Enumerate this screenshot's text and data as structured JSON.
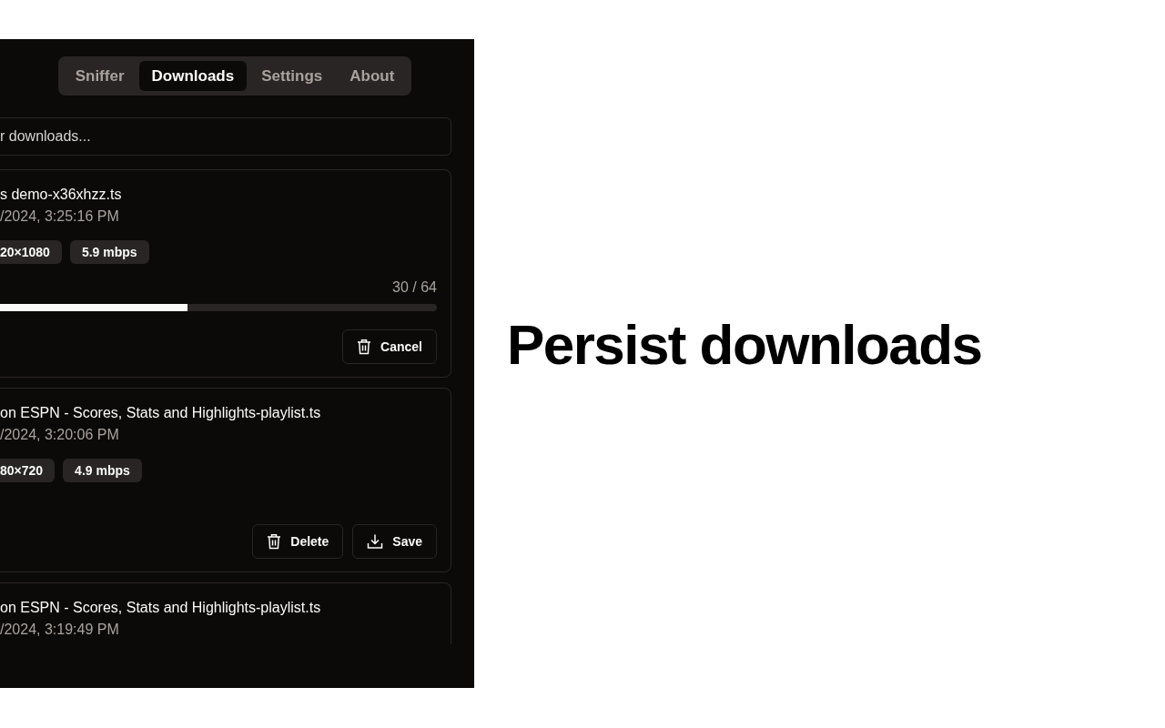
{
  "tabs": [
    {
      "label": "Sniffer",
      "selected": false
    },
    {
      "label": "Downloads",
      "selected": true
    },
    {
      "label": "Settings",
      "selected": false
    },
    {
      "label": "About",
      "selected": false
    }
  ],
  "search": {
    "placeholder": "r downloads..."
  },
  "downloads": [
    {
      "name": "s demo-x36xhzz.ts",
      "date": "/2024, 3:25:16 PM",
      "tags": [
        "20×1080",
        "5.9 mbps"
      ],
      "progress": {
        "reading": "30 / 64",
        "level": 0.43
      },
      "buttons": [
        {
          "kind": "delete",
          "label": "Cancel"
        }
      ]
    },
    {
      "name": "on ESPN - Scores, Stats and Highlights-playlist.ts",
      "date": "/2024, 3:20:06 PM",
      "tags": [
        "80×720",
        "4.9 mbps"
      ],
      "buttons": [
        {
          "kind": "delete",
          "label": "Delete"
        },
        {
          "kind": "save",
          "label": "Save"
        }
      ]
    },
    {
      "name": "on ESPN - Scores, Stats and Highlights-playlist.ts",
      "date": "/2024, 3:19:49 PM"
    }
  ],
  "headline": "Persist downloads"
}
